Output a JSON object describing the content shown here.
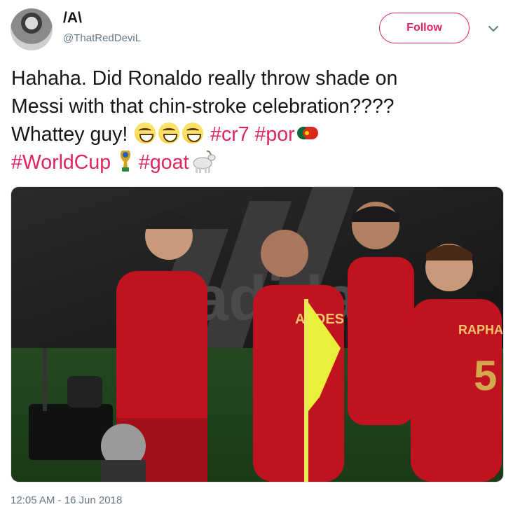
{
  "user": {
    "display_name": "/A\\",
    "handle": "@ThatRedDeviL"
  },
  "follow_label": "Follow",
  "tweet": {
    "line1": "Hahaha. Did Ronaldo really throw shade on",
    "line2": "Messi with that chin-stroke celebration????",
    "line3_text": "Whattey guy!",
    "hashtags": {
      "cr7": "#cr7",
      "por": "#por",
      "worldcup": "#WorldCup",
      "goat": "#goat"
    },
    "emojis": [
      "grinning-squinting-face",
      "grinning-squinting-face",
      "grinning-squinting-face",
      "portugal-flag",
      "world-cup-trophy",
      "goat"
    ]
  },
  "media": {
    "image_text": {
      "shirt_name_1": "ANDES",
      "shirt_name_2": "RAPHAEL",
      "shirt_number": "5",
      "brand": "adidas"
    }
  },
  "timestamp": "12:05 AM - 16 Jun 2018",
  "colors": {
    "accent": "#e0245e",
    "text": "#14171a",
    "muted": "#657786"
  }
}
